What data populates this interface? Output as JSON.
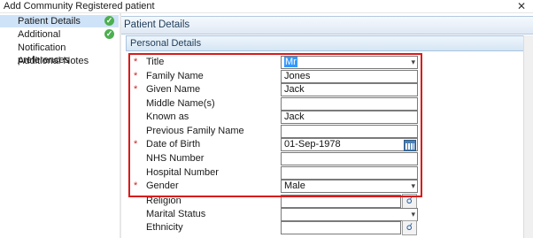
{
  "window": {
    "title": "Add Community Registered patient",
    "close_glyph": "✕"
  },
  "sidebar": {
    "items": [
      {
        "label": "Patient Details",
        "selected": true,
        "complete": true
      },
      {
        "label": "Additional",
        "selected": false,
        "complete": true
      },
      {
        "label": "Notification preferences",
        "selected": false,
        "complete": false
      },
      {
        "label": "Additional Notes",
        "selected": false,
        "complete": false
      }
    ]
  },
  "panel": {
    "title": "Patient Details",
    "section": "Personal Details"
  },
  "form": {
    "required_mark": "*",
    "fields": [
      {
        "label": "Title",
        "value": "Mr",
        "type": "combo",
        "required": true
      },
      {
        "label": "Family Name",
        "value": "Jones",
        "type": "text",
        "required": true
      },
      {
        "label": "Given Name",
        "value": "Jack",
        "type": "text",
        "required": true
      },
      {
        "label": "Middle Name(s)",
        "value": "",
        "type": "text",
        "required": false
      },
      {
        "label": "Known as",
        "value": "Jack",
        "type": "text",
        "required": false
      },
      {
        "label": "Previous Family Name",
        "value": "",
        "type": "text",
        "required": false
      },
      {
        "label": "Date of Birth",
        "value": "01-Sep-1978",
        "type": "date",
        "required": true
      },
      {
        "label": "NHS Number",
        "value": "",
        "type": "text",
        "required": false
      },
      {
        "label": "Hospital Number",
        "value": "",
        "type": "text",
        "required": false
      },
      {
        "label": "Gender",
        "value": "Male",
        "type": "combo",
        "required": true
      },
      {
        "label": "Religion",
        "value": "",
        "type": "lookup",
        "required": false
      },
      {
        "label": "Marital Status",
        "value": "",
        "type": "combo",
        "required": false
      },
      {
        "label": "Ethnicity",
        "value": "",
        "type": "lookup",
        "required": false
      }
    ]
  },
  "icons": {
    "check": "check-circle-icon",
    "calendar": "calendar-icon",
    "lookup": "magnifier-icon",
    "dropdown": "chevron-down-icon"
  },
  "colors": {
    "highlight_border": "#d81b1b",
    "required": "#cc2222",
    "check": "#4caf50",
    "selection": "#cfe3f8"
  }
}
